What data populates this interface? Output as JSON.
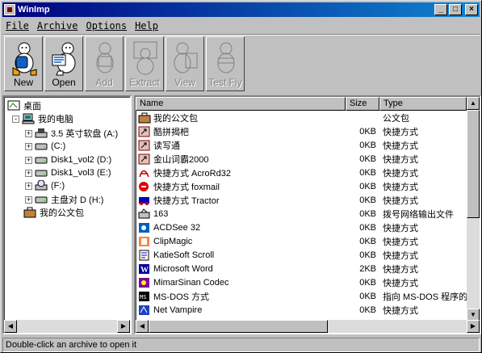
{
  "window": {
    "title": "WinImp"
  },
  "menu": [
    "File",
    "Archive",
    "Options",
    "Help"
  ],
  "toolbar": [
    {
      "label": "New",
      "enabled": true,
      "icon": "new-archive-icon"
    },
    {
      "label": "Open",
      "enabled": true,
      "icon": "open-archive-icon"
    },
    {
      "label": "Add",
      "enabled": false,
      "icon": "add-icon"
    },
    {
      "label": "Extract",
      "enabled": false,
      "icon": "extract-icon"
    },
    {
      "label": "View",
      "enabled": false,
      "icon": "view-icon"
    },
    {
      "label": "Test Fly",
      "enabled": false,
      "icon": "test-fly-icon"
    }
  ],
  "tree": [
    {
      "label": "桌面",
      "icon": "desktop-icon",
      "level": 0,
      "expander": ""
    },
    {
      "label": "我的电脑",
      "icon": "computer-icon",
      "level": 1,
      "expander": "-"
    },
    {
      "label": "3.5 英寸软盘 (A:)",
      "icon": "floppy-drive-icon",
      "level": 2,
      "expander": "+"
    },
    {
      "label": "(C:)",
      "icon": "hard-drive-icon",
      "level": 2,
      "expander": "+"
    },
    {
      "label": "Disk1_vol2 (D:)",
      "icon": "hard-drive-icon",
      "level": 2,
      "expander": "+"
    },
    {
      "label": "Disk1_vol3 (E:)",
      "icon": "hard-drive-icon",
      "level": 2,
      "expander": "+"
    },
    {
      "label": "(F:)",
      "icon": "cdrom-drive-icon",
      "level": 2,
      "expander": "+"
    },
    {
      "label": "主盘对 D (H:)",
      "icon": "hard-drive-icon",
      "level": 2,
      "expander": "+"
    },
    {
      "label": "我的公文包",
      "icon": "briefcase-icon",
      "level": 1,
      "expander": ""
    }
  ],
  "list": {
    "columns": {
      "name": "Name",
      "size": "Size",
      "type": "Type"
    },
    "rows": [
      {
        "name": "我的公文包",
        "size": "",
        "type": "公文包",
        "icon": "briefcase-icon"
      },
      {
        "name": "酷拼揭杷",
        "size": "0KB",
        "type": "快捷方式",
        "icon": "shortcut-icon"
      },
      {
        "name": "读写通",
        "size": "0KB",
        "type": "快捷方式",
        "icon": "shortcut-icon"
      },
      {
        "name": "金山词霸2000",
        "size": "0KB",
        "type": "快捷方式",
        "icon": "shortcut-icon"
      },
      {
        "name": "快捷方式 AcroRd32",
        "size": "0KB",
        "type": "快捷方式",
        "icon": "acrobat-icon"
      },
      {
        "name": "快捷方式 foxmail",
        "size": "0KB",
        "type": "快捷方式",
        "icon": "foxmail-icon"
      },
      {
        "name": "快捷方式 Tractor",
        "size": "0KB",
        "type": "快捷方式",
        "icon": "tractor-icon"
      },
      {
        "name": "163",
        "size": "0KB",
        "type": "拨号网络输出文件",
        "icon": "dialup-icon"
      },
      {
        "name": "ACDSee 32",
        "size": "0KB",
        "type": "快捷方式",
        "icon": "acdsee-icon"
      },
      {
        "name": "ClipMagic",
        "size": "0KB",
        "type": "快捷方式",
        "icon": "clipmagic-icon"
      },
      {
        "name": "KatieSoft Scroll",
        "size": "0KB",
        "type": "快捷方式",
        "icon": "scroll-icon"
      },
      {
        "name": "Microsoft Word",
        "size": "2KB",
        "type": "快捷方式",
        "icon": "word-icon"
      },
      {
        "name": "MimarSinan Codec",
        "size": "0KB",
        "type": "快捷方式",
        "icon": "codec-icon"
      },
      {
        "name": "MS-DOS 方式",
        "size": "0KB",
        "type": "指向 MS-DOS 程序的",
        "icon": "msdos-icon"
      },
      {
        "name": "Net Vampire",
        "size": "0KB",
        "type": "快捷方式",
        "icon": "netvampire-icon"
      }
    ]
  },
  "status": "Double-click an archive to open it"
}
